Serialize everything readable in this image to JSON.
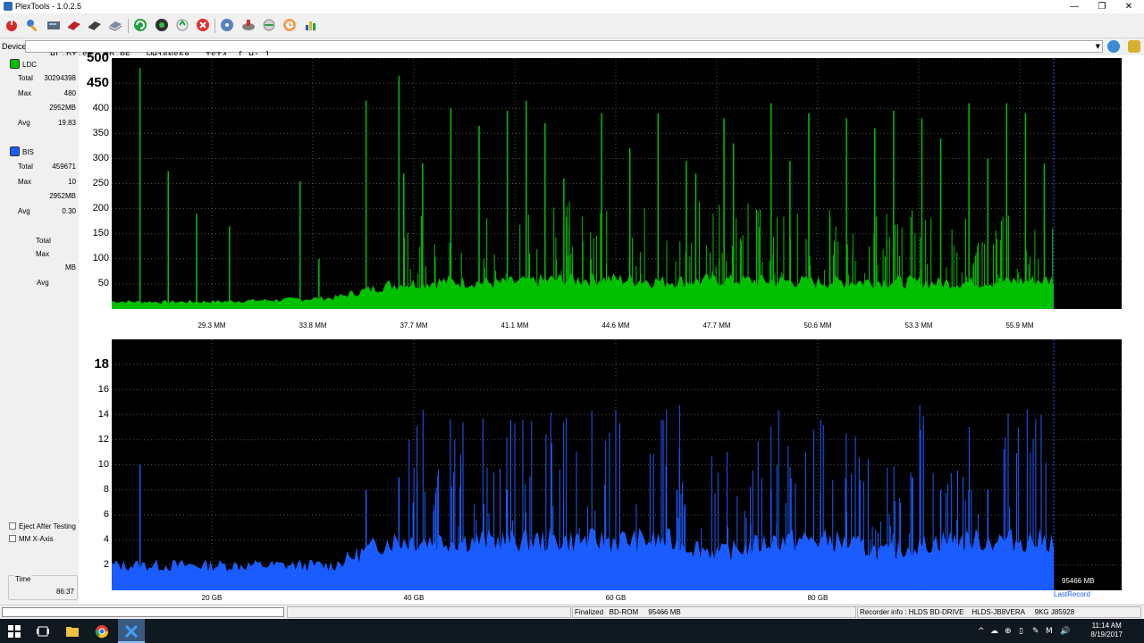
{
  "window": {
    "title": "PlexTools - 1.0.2.5",
    "minimize_glyph": "—",
    "maximize_glyph": "❐",
    "close_glyph": "✕"
  },
  "toolbar": {
    "buttons": [
      "power-icon",
      "wrench-icon",
      "drive-info-icon",
      "disc-red-icon",
      "disc-black-icon",
      "disc-stack-icon",
      "refresh-icon",
      "globe-icon",
      "recycle-icon",
      "stop-icon",
      "cd-icon",
      "disc-write-icon",
      "scan-icon",
      "clock-icon",
      "chart-icon"
    ]
  },
  "device": {
    "label": "Device:",
    "value": "HL-DT-ST  BD-RE   WH16NS58   TST4  [ H: ]"
  },
  "left_panel": {
    "ldc": {
      "label": "LDC",
      "color": "#00c000",
      "total_label": "Total",
      "total": "30294398",
      "max_label": "Max",
      "max": "480",
      "mb": "2952MB",
      "avg_label": "Avg",
      "avg": "19.83"
    },
    "bis": {
      "label": "BIS",
      "color": "#1a5cff",
      "total_label": "Total",
      "total": "459671",
      "max_label": "Max",
      "max": "10",
      "mb": "2952MB",
      "avg_label": "Avg",
      "avg": "0.30"
    },
    "third": {
      "total_label": "Total",
      "max_label": "Max",
      "mb_label": "MB",
      "avg_label": "Avg"
    },
    "eject_label": "Eject After Testing",
    "eject_checked": false,
    "mmx_label": "MM X-Axis",
    "mmx_checked": false,
    "time_label": "Time",
    "time_value": "86:37"
  },
  "chart_data": [
    {
      "type": "area",
      "series": [
        {
          "values": [
            15,
            14,
            15,
            18,
            22,
            48,
            55,
            52,
            58,
            60,
            55,
            58,
            56,
            54,
            55,
            52,
            55,
            58
          ]
        }
      ],
      "x_tick_labels": [
        "29.3 MM",
        "33.8 MM",
        "37.7 MM",
        "41.1 MM",
        "44.6 MM",
        "47.7 MM",
        "50.6 MM",
        "53.3 MM",
        "55.9 MM"
      ],
      "y_ticks": [
        50,
        100,
        150,
        200,
        250,
        300,
        350,
        400,
        450,
        500
      ],
      "ylim": [
        0,
        500
      ],
      "spikes": [
        [
          0.03,
          480
        ],
        [
          0.06,
          275
        ],
        [
          0.09,
          190
        ],
        [
          0.125,
          165
        ],
        [
          0.2,
          255
        ],
        [
          0.22,
          100
        ],
        [
          0.27,
          415
        ],
        [
          0.305,
          465
        ],
        [
          0.31,
          270
        ],
        [
          0.33,
          290
        ],
        [
          0.36,
          400
        ],
        [
          0.39,
          365
        ],
        [
          0.42,
          395
        ],
        [
          0.44,
          415
        ],
        [
          0.46,
          370
        ],
        [
          0.48,
          260
        ],
        [
          0.52,
          390
        ],
        [
          0.55,
          320
        ],
        [
          0.58,
          390
        ],
        [
          0.61,
          295
        ],
        [
          0.62,
          270
        ],
        [
          0.65,
          380
        ],
        [
          0.66,
          330
        ],
        [
          0.7,
          410
        ],
        [
          0.72,
          295
        ],
        [
          0.74,
          390
        ],
        [
          0.78,
          380
        ],
        [
          0.81,
          360
        ],
        [
          0.83,
          395
        ],
        [
          0.86,
          380
        ],
        [
          0.88,
          340
        ],
        [
          0.91,
          410
        ],
        [
          0.93,
          300
        ],
        [
          0.95,
          410
        ],
        [
          0.97,
          390
        ],
        [
          0.99,
          290
        ]
      ],
      "grid": true
    },
    {
      "type": "area",
      "series": [
        {
          "values": [
            2,
            2,
            2,
            2,
            2,
            4,
            4,
            4,
            4,
            4,
            4,
            3,
            4,
            4,
            3,
            4,
            4,
            4
          ]
        }
      ],
      "x_tick_labels": [
        "20 GB",
        "40 GB",
        "60 GB",
        "80 GB"
      ],
      "y_ticks": [
        2,
        4,
        6,
        8,
        10,
        12,
        14,
        16,
        18
      ],
      "ylim": [
        0,
        20
      ],
      "spikes": [
        [
          0.03,
          10
        ],
        [
          0.27,
          8
        ],
        [
          0.305,
          9
        ],
        [
          0.32,
          7
        ],
        [
          0.37,
          8
        ],
        [
          0.42,
          8
        ],
        [
          0.6,
          8
        ],
        [
          0.7,
          8
        ],
        [
          0.85,
          9
        ],
        [
          0.88,
          8
        ],
        [
          0.91,
          8
        ],
        [
          0.93,
          8
        ]
      ],
      "grid": true,
      "end_label": "95466 MB",
      "last_record_label": "LastRecord"
    }
  ],
  "status": {
    "finalized": "Finalized   BD-ROM     95466 MB",
    "recorder": "Recorder info : HLDS BD-DRIVE    HLDS-JB8VERA     9KG J85928"
  },
  "taskbar": {
    "time": "11:14 AM",
    "date": "8/19/2017",
    "tray": [
      "^",
      "☁",
      "⊕",
      "▯",
      "✎",
      "M",
      "🔊"
    ]
  }
}
